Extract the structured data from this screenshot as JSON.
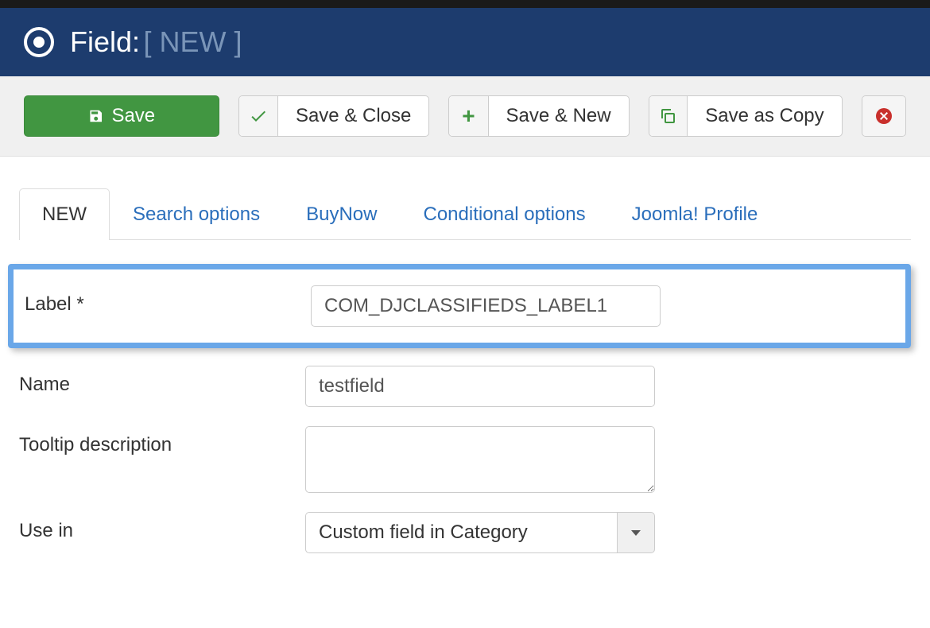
{
  "header": {
    "title": "Field:",
    "subtitle": "[ NEW ]"
  },
  "toolbar": {
    "save": "Save",
    "save_close": "Save & Close",
    "save_new": "Save & New",
    "save_copy": "Save as Copy"
  },
  "tabs": {
    "new": "NEW",
    "search_options": "Search options",
    "buynow": "BuyNow",
    "conditional": "Conditional options",
    "joomla_profile": "Joomla! Profile"
  },
  "form": {
    "label_field": {
      "label": "Label *",
      "value": "COM_DJCLASSIFIEDS_LABEL1"
    },
    "name_field": {
      "label": "Name",
      "value": "testfield"
    },
    "tooltip_field": {
      "label": "Tooltip description",
      "value": ""
    },
    "use_in_field": {
      "label": "Use in",
      "value": "Custom field in Category"
    }
  }
}
